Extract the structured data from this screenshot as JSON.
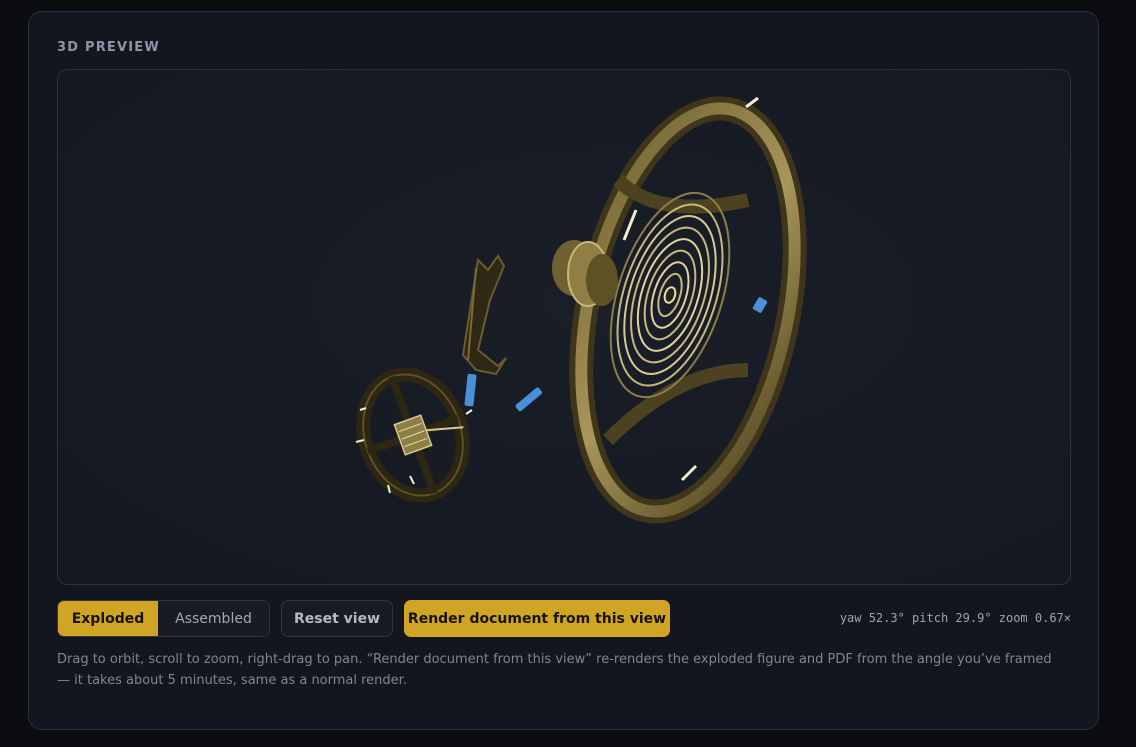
{
  "section": {
    "title": "3D PREVIEW"
  },
  "view_mode": {
    "options": [
      "Exploded",
      "Assembled"
    ],
    "selected": "Exploded"
  },
  "toolbar": {
    "reset_label": "Reset view",
    "render_label": "Render document from this view"
  },
  "camera": {
    "readout": "yaw 52.3° pitch 29.9° zoom 0.67×"
  },
  "hint": {
    "text": "Drag to orbit, scroll to zoom, right-drag to pan. “Render document from this view” re-renders the exploded figure and PDF from the angle you’ve framed — it takes about 5 minutes, same as a normal render."
  },
  "colors": {
    "accent": "#d1a524",
    "brass": "#8a7a3e",
    "jewel": "#4a8fd8"
  }
}
